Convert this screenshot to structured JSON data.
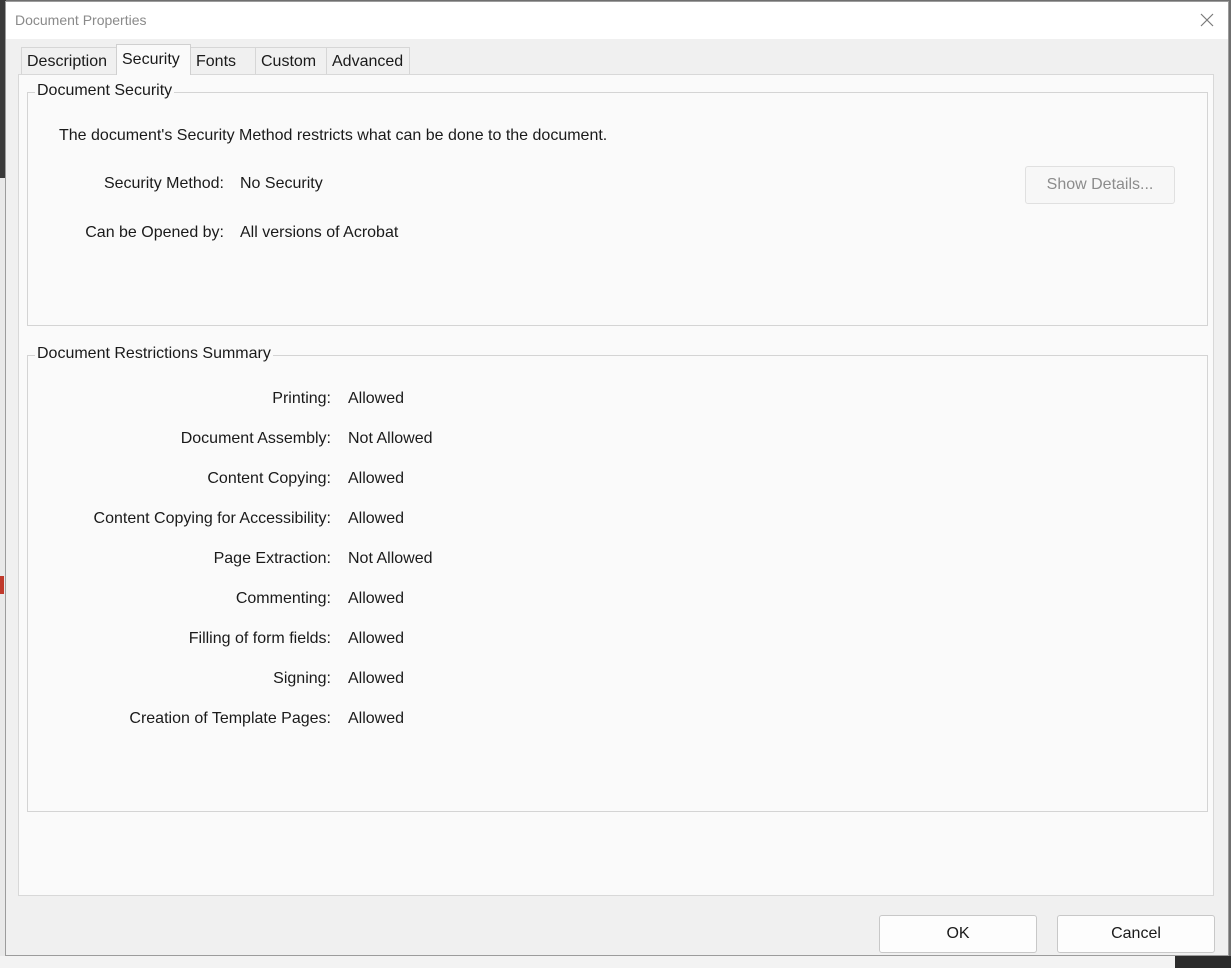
{
  "dialog": {
    "title": "Document Properties"
  },
  "tabs": [
    {
      "label": "Description"
    },
    {
      "label": "Security"
    },
    {
      "label": "Fonts"
    },
    {
      "label": "Custom"
    },
    {
      "label": "Advanced"
    }
  ],
  "security": {
    "group_title": "Document Security",
    "intro": "The document's Security Method restricts what can be done to the document.",
    "method_label": "Security Method:",
    "method_value": "No Security",
    "opened_label": "Can be Opened by:",
    "opened_value": "All versions of Acrobat",
    "show_details_label": "Show Details..."
  },
  "restrictions": {
    "group_title": "Document Restrictions Summary",
    "rows": [
      {
        "label": "Printing:",
        "value": "Allowed"
      },
      {
        "label": "Document Assembly:",
        "value": "Not Allowed"
      },
      {
        "label": "Content Copying:",
        "value": "Allowed"
      },
      {
        "label": "Content Copying for Accessibility:",
        "value": "Allowed"
      },
      {
        "label": "Page Extraction:",
        "value": "Not Allowed"
      },
      {
        "label": "Commenting:",
        "value": "Allowed"
      },
      {
        "label": "Filling of form fields:",
        "value": "Allowed"
      },
      {
        "label": "Signing:",
        "value": "Allowed"
      },
      {
        "label": "Creation of Template Pages:",
        "value": "Allowed"
      }
    ]
  },
  "buttons": {
    "ok": "OK",
    "cancel": "Cancel"
  },
  "icons": {
    "close": "close-icon"
  }
}
